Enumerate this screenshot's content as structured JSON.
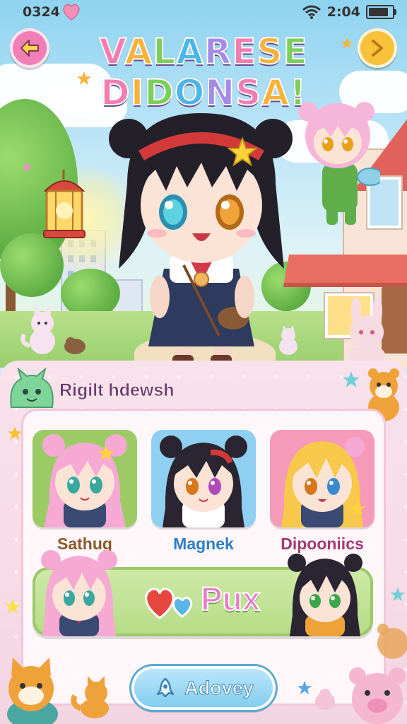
{
  "status": {
    "time": "0324",
    "clock": "2:04",
    "battery_level": 0.85
  },
  "header": {
    "title_line1": [
      "V",
      "A",
      "L",
      "A",
      "R",
      "E",
      "S",
      "E"
    ],
    "title_line2": [
      "D",
      "I",
      "D",
      "O",
      "N",
      "S",
      "A",
      "!"
    ],
    "title_colors": [
      "#f27db2",
      "#f7b23a",
      "#7ccf5a",
      "#4db6e8",
      "#a58be8",
      "#f27db2",
      "#f7b23a",
      "#7ccf5a"
    ],
    "back_icon": "arrow-left-icon",
    "next_icon": "chevron-right-icon"
  },
  "panel": {
    "section_title": "Rigilt hdewsh",
    "characters": [
      {
        "name": "Sathug",
        "name_color": "#8a5a2b",
        "bg": "#9ccb66",
        "hair": "#f5a9d3"
      },
      {
        "name": "Magnek",
        "name_color": "#2f7fc4",
        "bg": "#8fd0f2",
        "hair": "#2a2530"
      },
      {
        "name": "Dipooniics",
        "name_color": "#a23a75",
        "bg": "#f59ab9",
        "hair": "#f7c84a"
      }
    ],
    "action_label": "Pux",
    "bottom_button_label": "Adovey"
  },
  "colors": {
    "accent_pink": "#f07fb5",
    "accent_yellow": "#f7c23a",
    "panel_bg": "#f9e2ec"
  }
}
